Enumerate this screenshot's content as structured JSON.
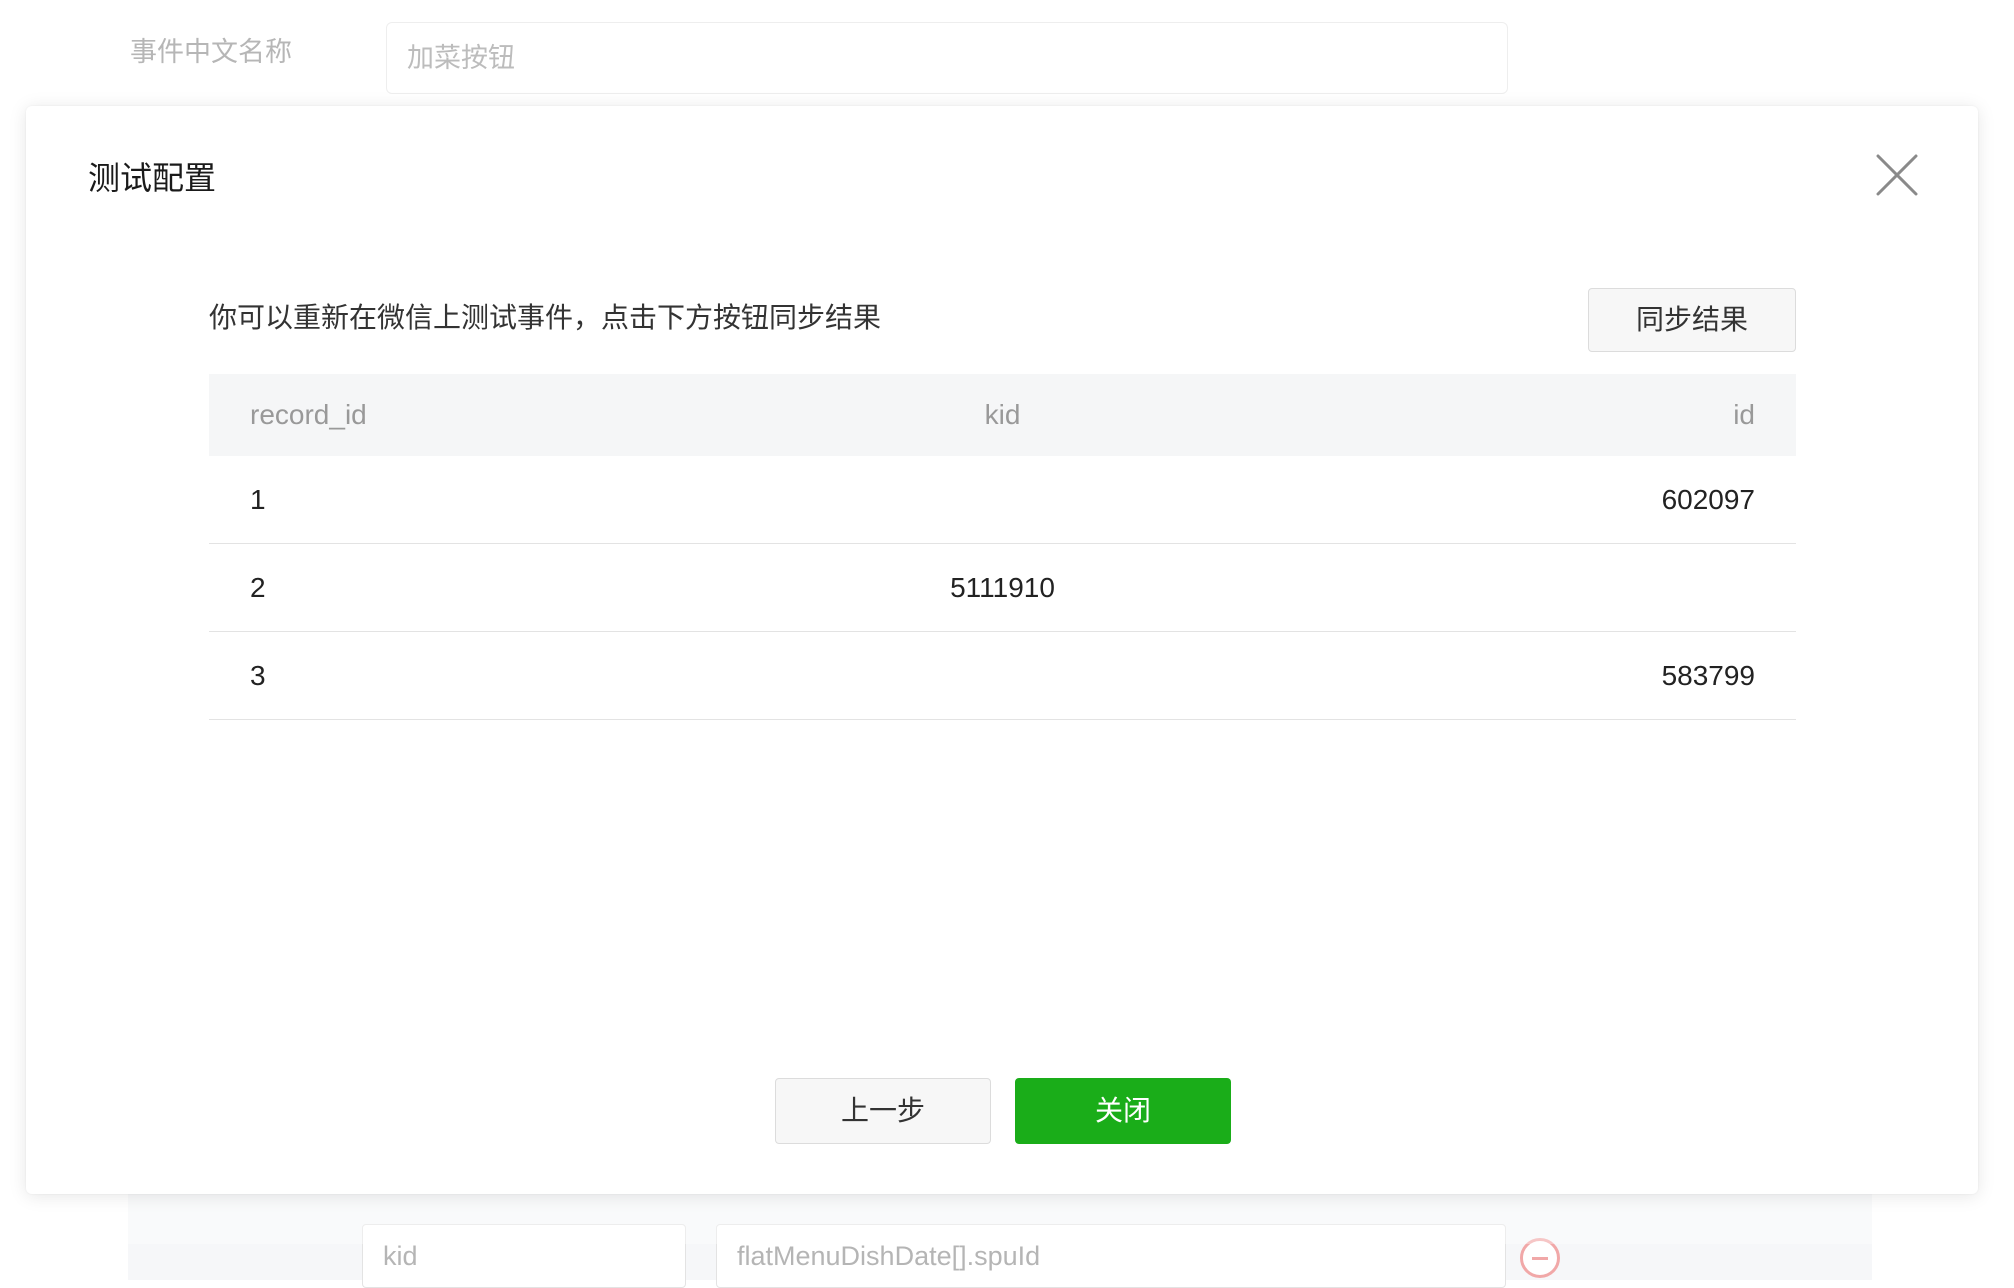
{
  "background": {
    "form": {
      "label": "事件中文名称",
      "input_value": "加菜按钮"
    },
    "bottom_row": {
      "kid_field": "kid",
      "path_field": "flatMenuDishDate[].spuId"
    }
  },
  "dialog": {
    "title": "测试配置",
    "hint": "你可以重新在微信上测试事件，点击下方按钮同步结果",
    "sync_button": "同步结果",
    "table": {
      "columns": [
        "record_id",
        "kid",
        "id"
      ],
      "rows": [
        [
          "1",
          "",
          "602097"
        ],
        [
          "2",
          "5111910",
          ""
        ],
        [
          "3",
          "",
          "583799"
        ]
      ]
    },
    "footer": {
      "prev_label": "上一步",
      "close_label": "关闭"
    }
  },
  "colors": {
    "primary": "#1aad19",
    "danger": "#f1a8a8",
    "header_bg": "#f5f6f7"
  },
  "icons": {
    "close": "close-icon",
    "remove": "remove-circle-icon"
  }
}
